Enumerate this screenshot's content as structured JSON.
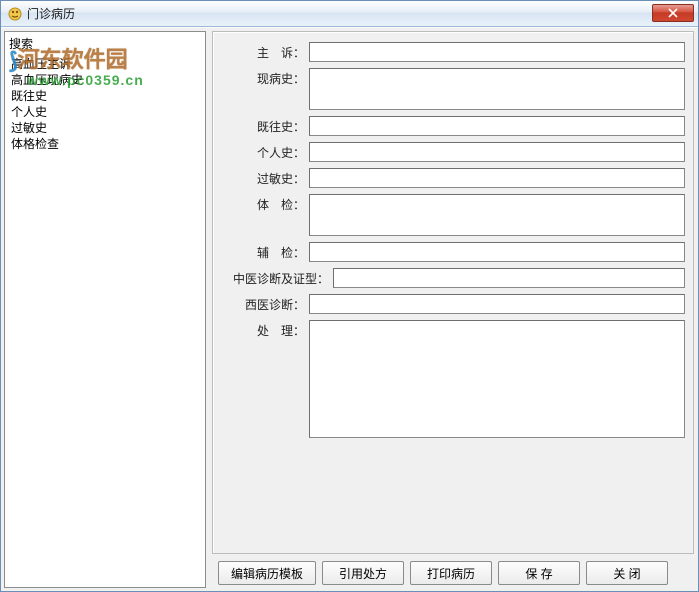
{
  "window": {
    "title": "门诊病历"
  },
  "watermark": {
    "line1_a": "河东软件园",
    "url": "www.pc0359.cn"
  },
  "sidebar": {
    "search_label": "搜索",
    "items": [
      "高血压主诉",
      "高血压现病史",
      "既往史",
      "个人史",
      "过敏史",
      "体格检查"
    ]
  },
  "form": {
    "fields": {
      "chief_complaint_label": "主　诉：",
      "present_history_label": "现病史：",
      "past_history_label": "既往史：",
      "personal_history_label": "个人史：",
      "allergy_history_label": "过敏史：",
      "exam_label": "体　检：",
      "aux_exam_label": "辅　检：",
      "tcm_diagnosis_label": "中医诊断及证型：",
      "wm_diagnosis_label": "西医诊断：",
      "treatment_label": "处　理："
    },
    "values": {
      "chief_complaint": "",
      "present_history": "",
      "past_history": "",
      "personal_history": "",
      "allergy_history": "",
      "exam": "",
      "aux_exam": "",
      "tcm_diagnosis": "",
      "wm_diagnosis": "",
      "treatment": ""
    }
  },
  "buttons": {
    "edit_template": "编辑病历模板",
    "quote_prescription": "引用处方",
    "print_record": "打印病历",
    "save": "保 存",
    "close": "关 闭"
  }
}
